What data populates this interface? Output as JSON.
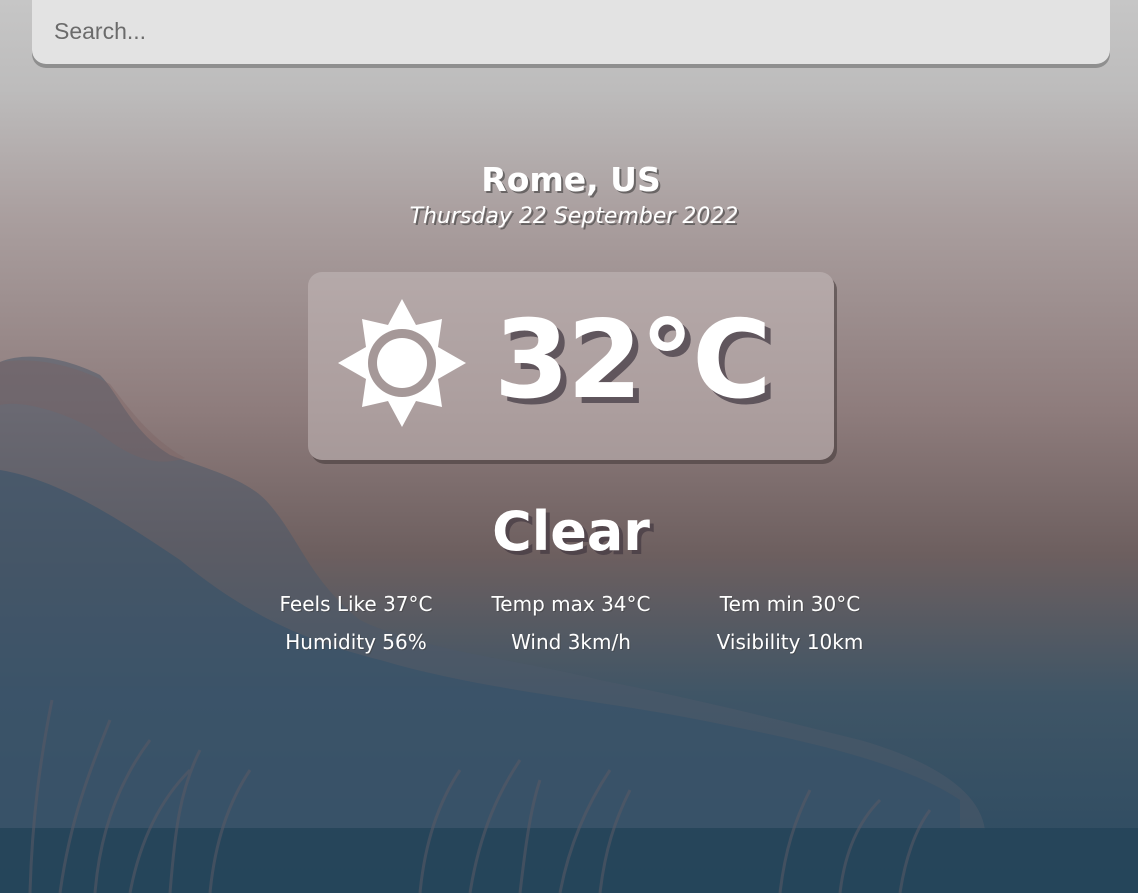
{
  "search": {
    "placeholder": "Search..."
  },
  "location": {
    "city": "Rome, US",
    "date": "Thursday 22 September 2022"
  },
  "current": {
    "icon": "sun-icon",
    "temperature": "32°C",
    "condition": "Clear"
  },
  "stats": {
    "feels_like": "Feels Like 37°C",
    "temp_max": "Temp max 34°C",
    "temp_min": "Tem min 30°C",
    "humidity": "Humidity 56%",
    "wind": "Wind 3km/h",
    "visibility": "Visibility 10km"
  },
  "colors": {
    "card": "#c4baba",
    "text": "#ffffff",
    "search_bg": "#e3e3e3"
  }
}
